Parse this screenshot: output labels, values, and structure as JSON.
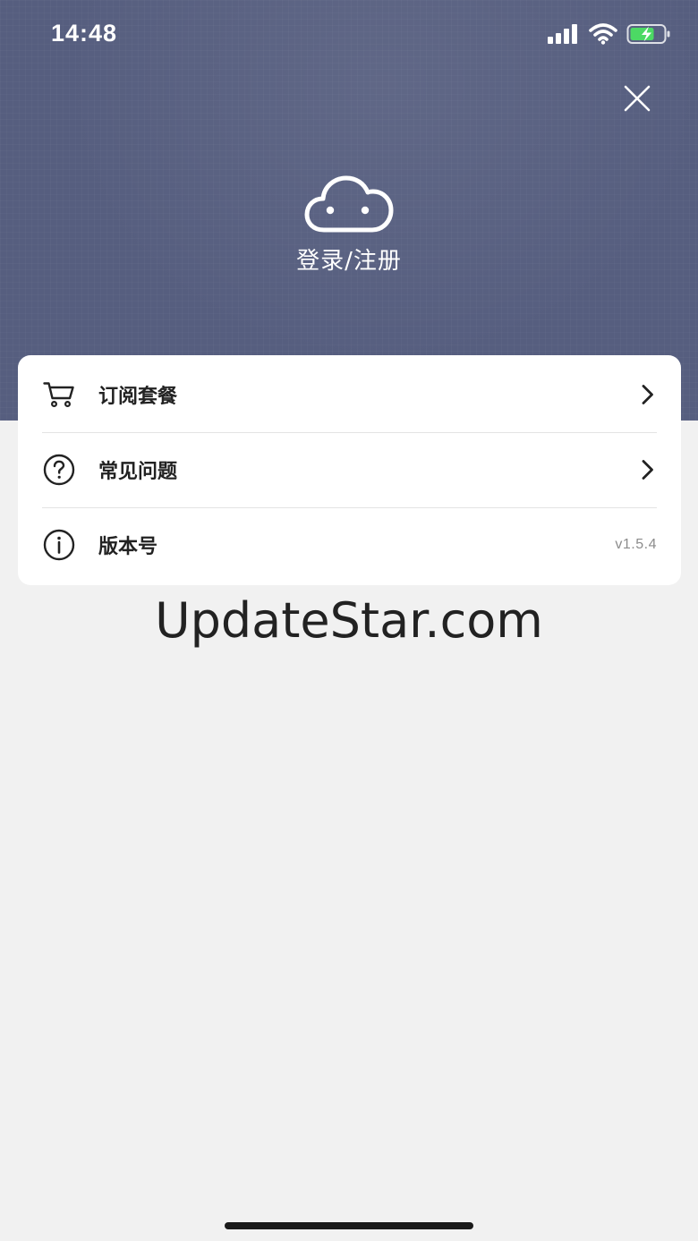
{
  "status_bar": {
    "time": "14:48",
    "icons": [
      "signal-icon",
      "wifi-icon",
      "battery-charging-icon"
    ]
  },
  "header": {
    "close_icon": "close-icon",
    "avatar_icon": "cloud-face-icon",
    "login_label": "登录/注册"
  },
  "menu": {
    "items": [
      {
        "label": "订阅套餐",
        "icon": "cart-icon",
        "trailing": "chevron-right-icon"
      },
      {
        "label": "常见问题",
        "icon": "help-circle-icon",
        "trailing": "chevron-right-icon"
      },
      {
        "label": "版本号",
        "icon": "info-circle-icon",
        "value": "v1.5.4"
      }
    ]
  },
  "watermark": "UpdateStar.com",
  "colors": {
    "header_bg": "#565e7f",
    "page_bg": "#f1f1f1",
    "card_bg": "#ffffff",
    "battery_green": "#4cd964"
  }
}
